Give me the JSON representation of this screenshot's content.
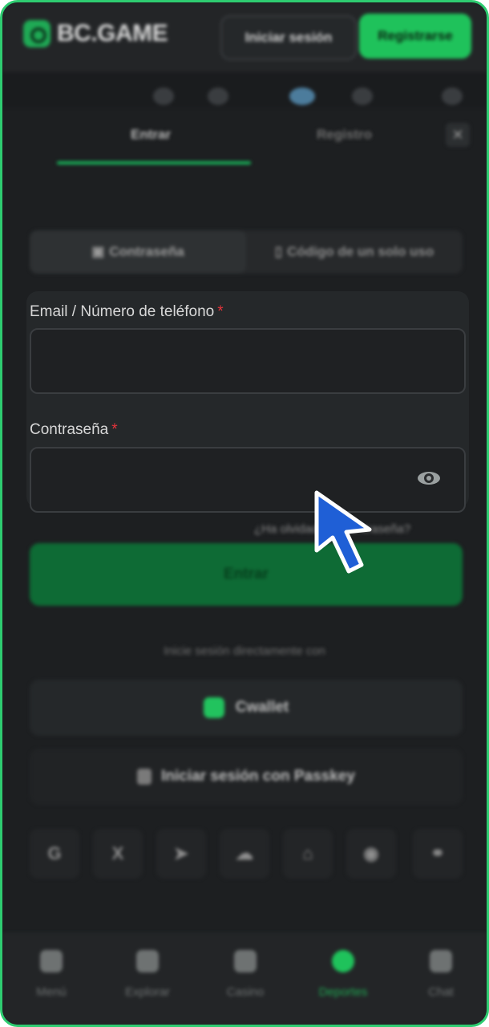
{
  "header": {
    "logo_text": "BC.GAME",
    "login_label": "Iniciar sesión",
    "register_label": "Registrarse"
  },
  "modal": {
    "tabs": [
      {
        "label": "Entrar"
      },
      {
        "label": "Registro"
      }
    ],
    "close_icon": "close-icon",
    "methods": [
      {
        "label": "Contraseña",
        "icon": "lock-icon"
      },
      {
        "label": "Código de un solo uso",
        "icon": "phone-icon"
      }
    ],
    "email_field": {
      "label": "Email / Número de teléfono",
      "required_mark": "*",
      "value": "",
      "placeholder": ""
    },
    "password_field": {
      "label": "Contraseña",
      "required_mark": "*",
      "value": "",
      "placeholder": ""
    },
    "forgot_password": "¿Ha olvidado su contraseña?",
    "submit_label": "Entrar",
    "direct_login_text": "Inicie sesión directamente con",
    "cwallet_label": "Cwallet",
    "passkey_label": "Iniciar sesión con Passkey",
    "social_icons": [
      "google-icon",
      "x-icon",
      "telegram-icon",
      "cloud-icon",
      "cloud-alt-icon",
      "whatsapp-icon",
      "link-icon"
    ]
  },
  "bottom_nav": {
    "items": [
      {
        "label": "Menú",
        "icon": "menu-icon"
      },
      {
        "label": "Explorar",
        "icon": "explore-icon"
      },
      {
        "label": "Casino",
        "icon": "casino-icon"
      },
      {
        "label": "Deportes",
        "icon": "sports-icon",
        "active": true
      },
      {
        "label": "Chat",
        "icon": "chat-icon"
      }
    ]
  },
  "colors": {
    "accent": "#1fc25b",
    "background": "#1d1f21",
    "frame_border": "#2ecc71",
    "cursor": "#1f5fd6"
  }
}
